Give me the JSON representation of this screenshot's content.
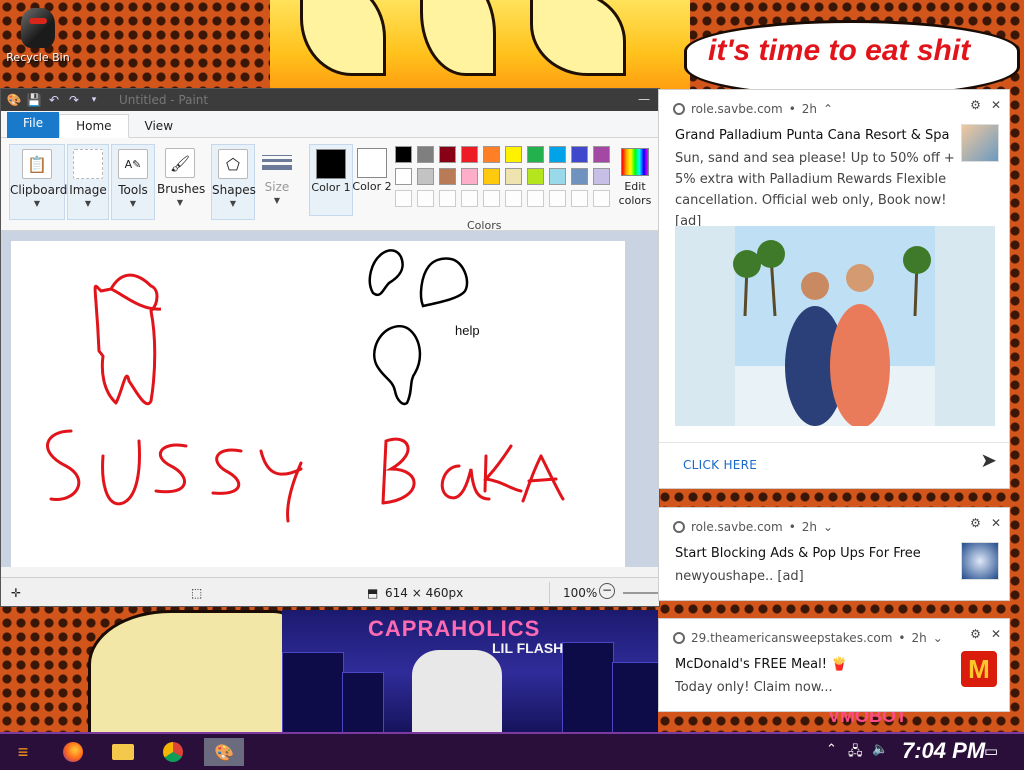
{
  "desktop": {
    "recycle_bin_label": "Recycle Bin",
    "speech_bubble": "it's time to eat shit",
    "album_title": "CAPRAHOLICS",
    "album_subtitle": "LIL FLASH",
    "overlay_text": "VMOBOT"
  },
  "paint": {
    "window_title": "Untitled - Paint",
    "tabs": [
      {
        "label": "File"
      },
      {
        "label": "Home"
      },
      {
        "label": "View"
      }
    ],
    "groups": [
      {
        "label": "Clipboard"
      },
      {
        "label": "Image"
      },
      {
        "label": "Tools"
      },
      {
        "label": "Brushes"
      },
      {
        "label": "Shapes"
      },
      {
        "label": "Size"
      }
    ],
    "color1": {
      "label": "Color 1",
      "value": "#000000"
    },
    "color2": {
      "label": "Color 2",
      "value": "#ffffff"
    },
    "colors_group_label": "Colors",
    "edit_colors_label": "Edit colors",
    "palette_row1": [
      "#000000",
      "#7f7f7f",
      "#880015",
      "#ed1c24",
      "#ff7f27",
      "#fff200",
      "#22b14c",
      "#00a2e8",
      "#3f48cc",
      "#a349a4"
    ],
    "palette_row2": [
      "#ffffff",
      "#c3c3c3",
      "#b97a57",
      "#ffaec9",
      "#ffc90e",
      "#efe4b0",
      "#b5e61d",
      "#99d9ea",
      "#7092be",
      "#c8bfe7"
    ],
    "canvas_text": "help",
    "status": {
      "canvas_size": "614 × 460px",
      "zoom": "100%"
    }
  },
  "notifications": [
    {
      "source": "role.savbe.com",
      "time": "2h",
      "title": "Grand Palladium Punta Cana Resort & Spa",
      "body": "Sun, sand and sea please! Up to 50% off + 5% extra with Palladium Rewards Flexible cancellation. Official web only, Book now![ad]",
      "action": "CLICK HERE"
    },
    {
      "source": "role.savbe.com",
      "time": "2h",
      "title": "Start Blocking Ads & Pop Ups For Free",
      "body": "newyoushape.. [ad]"
    },
    {
      "source": "29.theamericansweepstakes.com",
      "time": "2h",
      "title": "McDonald's FREE Meal! 🍟",
      "body": "Today only! Claim now..."
    }
  ],
  "taskbar": {
    "clock": "7:04 PM"
  },
  "colors": {
    "accent_blue": "#1979ca",
    "drawing_red": "#e0141a",
    "taskbar_purple": "#2a0f3a"
  }
}
